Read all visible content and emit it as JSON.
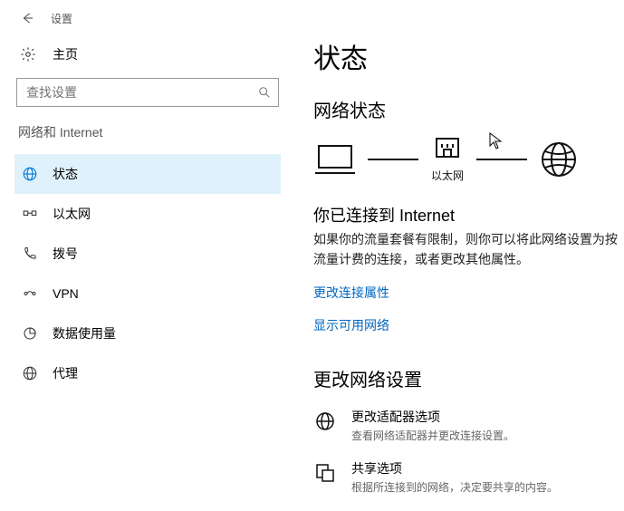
{
  "header": {
    "title": "设置"
  },
  "sidebar": {
    "home_label": "主页",
    "search_placeholder": "查找设置",
    "section_label": "网络和 Internet",
    "items": [
      {
        "label": "状态"
      },
      {
        "label": "以太网"
      },
      {
        "label": "拨号"
      },
      {
        "label": "VPN"
      },
      {
        "label": "数据使用量"
      },
      {
        "label": "代理"
      }
    ]
  },
  "main": {
    "title": "状态",
    "status_heading": "网络状态",
    "diagram": {
      "ethernet_label": "以太网"
    },
    "connected_heading": "你已连接到 Internet",
    "connected_desc": "如果你的流量套餐有限制，则你可以将此网络设置为按流量计费的连接，或者更改其他属性。",
    "link_change_props": "更改连接属性",
    "link_show_networks": "显示可用网络",
    "change_settings_heading": "更改网络设置",
    "options": [
      {
        "title": "更改适配器选项",
        "desc": "查看网络适配器并更改连接设置。"
      },
      {
        "title": "共享选项",
        "desc": "根据所连接到的网络，决定要共享的内容。"
      }
    ]
  }
}
